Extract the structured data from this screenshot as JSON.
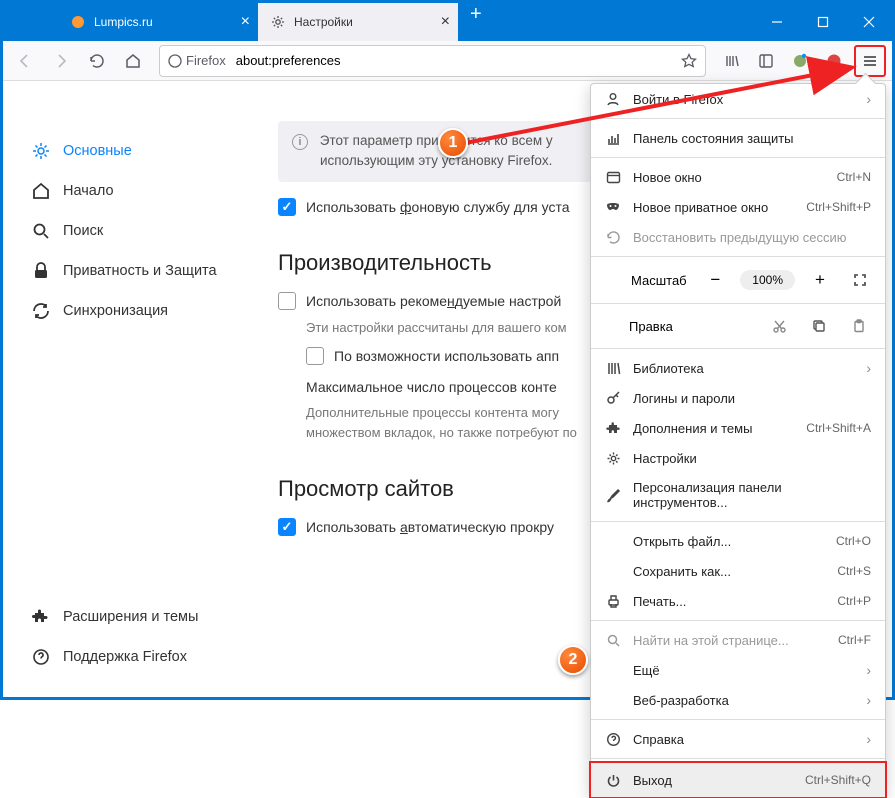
{
  "tabs": [
    {
      "title": "Lumpics.ru"
    },
    {
      "title": "Настройки"
    }
  ],
  "url": {
    "brand": "Firefox",
    "address": "about:preferences"
  },
  "sidebar": {
    "items": [
      {
        "label": "Основные"
      },
      {
        "label": "Начало"
      },
      {
        "label": "Поиск"
      },
      {
        "label": "Приватность и Защита"
      },
      {
        "label": "Синхронизация"
      }
    ],
    "bottom": [
      {
        "label": "Расширения и темы"
      },
      {
        "label": "Поддержка Firefox"
      }
    ]
  },
  "main": {
    "info_line1": "Этот параметр применится ко всем у",
    "info_line2": "использующим эту установку Firefox.",
    "cb1_pre": "Использовать ",
    "cb1_und": "ф",
    "cb1_post": "оновую службу для уста",
    "h_perf": "Производительность",
    "cb2_pre": "Использовать рекоме",
    "cb2_und": "н",
    "cb2_post": "дуемые настрой",
    "desc1": "Эти настройки рассчитаны для вашего ком",
    "cb3": "По возможности использовать апп",
    "proc": "Максимальное число процессов конте",
    "desc2a": "Дополнительные процессы контента могу",
    "desc2b": "множеством вкладок, но также потребуют по",
    "h_view": "Просмотр сайтов",
    "cb4_pre": "Использовать ",
    "cb4_und": "а",
    "cb4_post": "втоматическую прокру"
  },
  "menu": {
    "signin": "Войти в Firefox",
    "protection": "Панель состояния защиты",
    "newwin": "Новое окно",
    "newwin_s": "Ctrl+N",
    "priv": "Новое приватное окно",
    "priv_s": "Ctrl+Shift+P",
    "restore": "Восстановить предыдущую сессию",
    "zoom_label": "Масштаб",
    "zoom_val": "100%",
    "edit": "Правка",
    "library": "Библиотека",
    "logins": "Логины и пароли",
    "addons": "Дополнения и темы",
    "addons_s": "Ctrl+Shift+A",
    "settings": "Настройки",
    "customize": "Персонализация панели инструментов...",
    "open": "Открыть файл...",
    "open_s": "Ctrl+O",
    "save": "Сохранить как...",
    "save_s": "Ctrl+S",
    "print": "Печать...",
    "print_s": "Ctrl+P",
    "find": "Найти на этой странице...",
    "find_s": "Ctrl+F",
    "more": "Ещё",
    "webdev": "Веб-разработка",
    "help": "Справка",
    "exit": "Выход",
    "exit_s": "Ctrl+Shift+Q"
  },
  "markers": {
    "m1": "1",
    "m2": "2"
  }
}
